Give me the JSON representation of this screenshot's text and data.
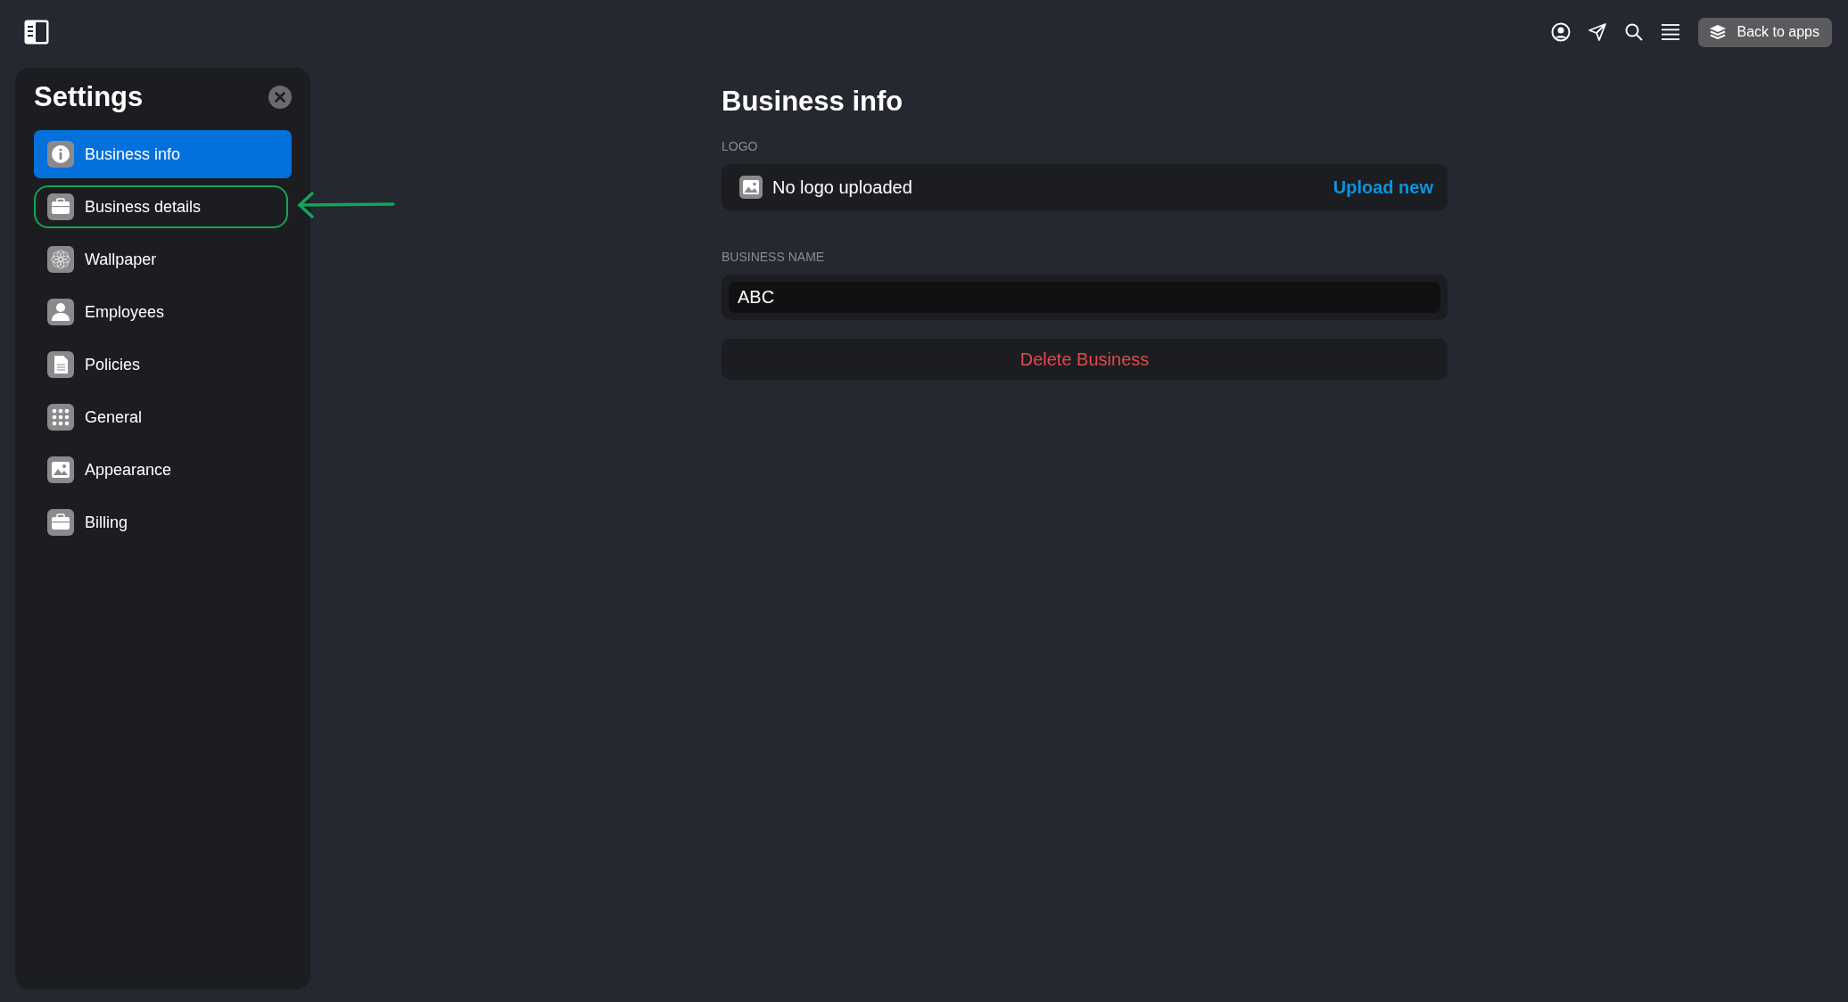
{
  "topbar": {
    "back_button": "Back to apps"
  },
  "sidebar": {
    "title": "Settings",
    "items": [
      {
        "label": "Business info",
        "selected": true,
        "outlined": false
      },
      {
        "label": "Business details",
        "selected": false,
        "outlined": true
      },
      {
        "label": "Wallpaper",
        "selected": false,
        "outlined": false
      },
      {
        "label": "Employees",
        "selected": false,
        "outlined": false
      },
      {
        "label": "Policies",
        "selected": false,
        "outlined": false
      },
      {
        "label": "General",
        "selected": false,
        "outlined": false
      },
      {
        "label": "Appearance",
        "selected": false,
        "outlined": false
      },
      {
        "label": "Billing",
        "selected": false,
        "outlined": false
      }
    ]
  },
  "content": {
    "title": "Business info",
    "logo": {
      "label": "LOGO",
      "status": "No logo uploaded",
      "action": "Upload new"
    },
    "business_name": {
      "label": "BUSINESS NAME",
      "value": "ABC"
    },
    "delete_button": "Delete Business"
  }
}
